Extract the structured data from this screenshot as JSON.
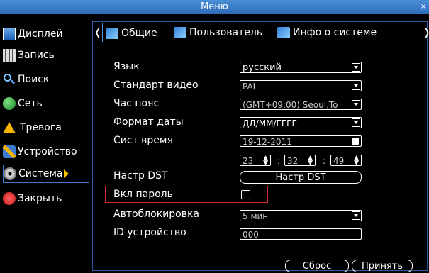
{
  "window": {
    "title": "Меню"
  },
  "sidebar": {
    "items": [
      {
        "label": "Дисплей",
        "icon": "display-icon"
      },
      {
        "label": "Запись",
        "icon": "record-icon"
      },
      {
        "label": "Поиск",
        "icon": "search-icon"
      },
      {
        "label": "Сеть",
        "icon": "network-icon"
      },
      {
        "label": "Тревога",
        "icon": "alarm-icon"
      },
      {
        "label": "Устройство",
        "icon": "device-icon"
      },
      {
        "label": "Система",
        "icon": "system-gear-icon",
        "active": true
      },
      {
        "label": "Закрыть",
        "icon": "power-icon"
      }
    ]
  },
  "tabs": [
    {
      "label": "Общие",
      "active": true
    },
    {
      "label": "Пользователь"
    },
    {
      "label": "Инфо о системе"
    }
  ],
  "form": {
    "language": {
      "label": "Язык",
      "value": "русский"
    },
    "video_standard": {
      "label": "Стандарт видео",
      "value": "PAL"
    },
    "timezone": {
      "label": "Час пояс",
      "value": "(GMT+09:00) Seoul,To"
    },
    "date_format": {
      "label": "Формат даты",
      "value": "ДД/ММ/ГГГГ"
    },
    "system_time": {
      "label": "Сист время",
      "date": "19-12-2011",
      "hour": "23",
      "minute": "32",
      "second": "49",
      "sep": ":"
    },
    "dst": {
      "label": "Настр DST",
      "button": "Настр DST"
    },
    "password": {
      "label": "Вкл пароль"
    },
    "autolock": {
      "label": "Автоблокировка",
      "value": "5 мин"
    },
    "device_id": {
      "label": "ID устройство",
      "value": "000"
    }
  },
  "footer": {
    "reset": "Сброс",
    "apply": "Принять"
  },
  "colors": {
    "titlebar": "#2d6ab8",
    "highlight": "#d9282a",
    "accent": "#f5c400"
  }
}
